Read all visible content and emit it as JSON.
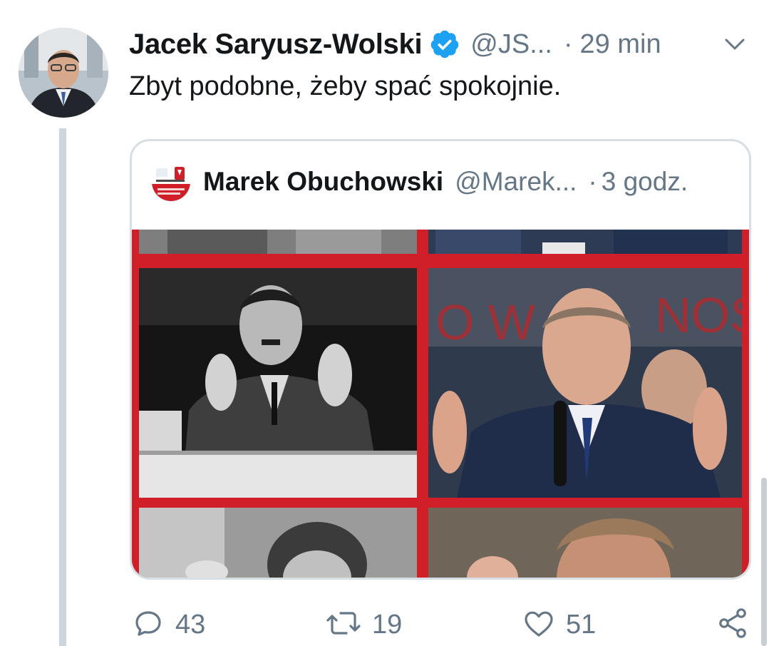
{
  "tweet": {
    "author_name": "Jacek Saryusz-Wolski",
    "handle": "@JS...",
    "separator": "·",
    "time": "29 min",
    "text": "Zbyt podobne, żeby spać spokojnie.",
    "verified": true
  },
  "quoted": {
    "author_name": "Marek Obuchowski",
    "handle": "@Marek...",
    "separator": "·",
    "time": "3 godz.",
    "media_icons": [
      "photo-collage"
    ]
  },
  "actions": {
    "replies": "43",
    "retweets": "19",
    "likes": "51"
  },
  "colors": {
    "accent": "#1da1f2",
    "muted": "#657786",
    "border": "#d7dee4",
    "collage_red": "#d01f28"
  }
}
